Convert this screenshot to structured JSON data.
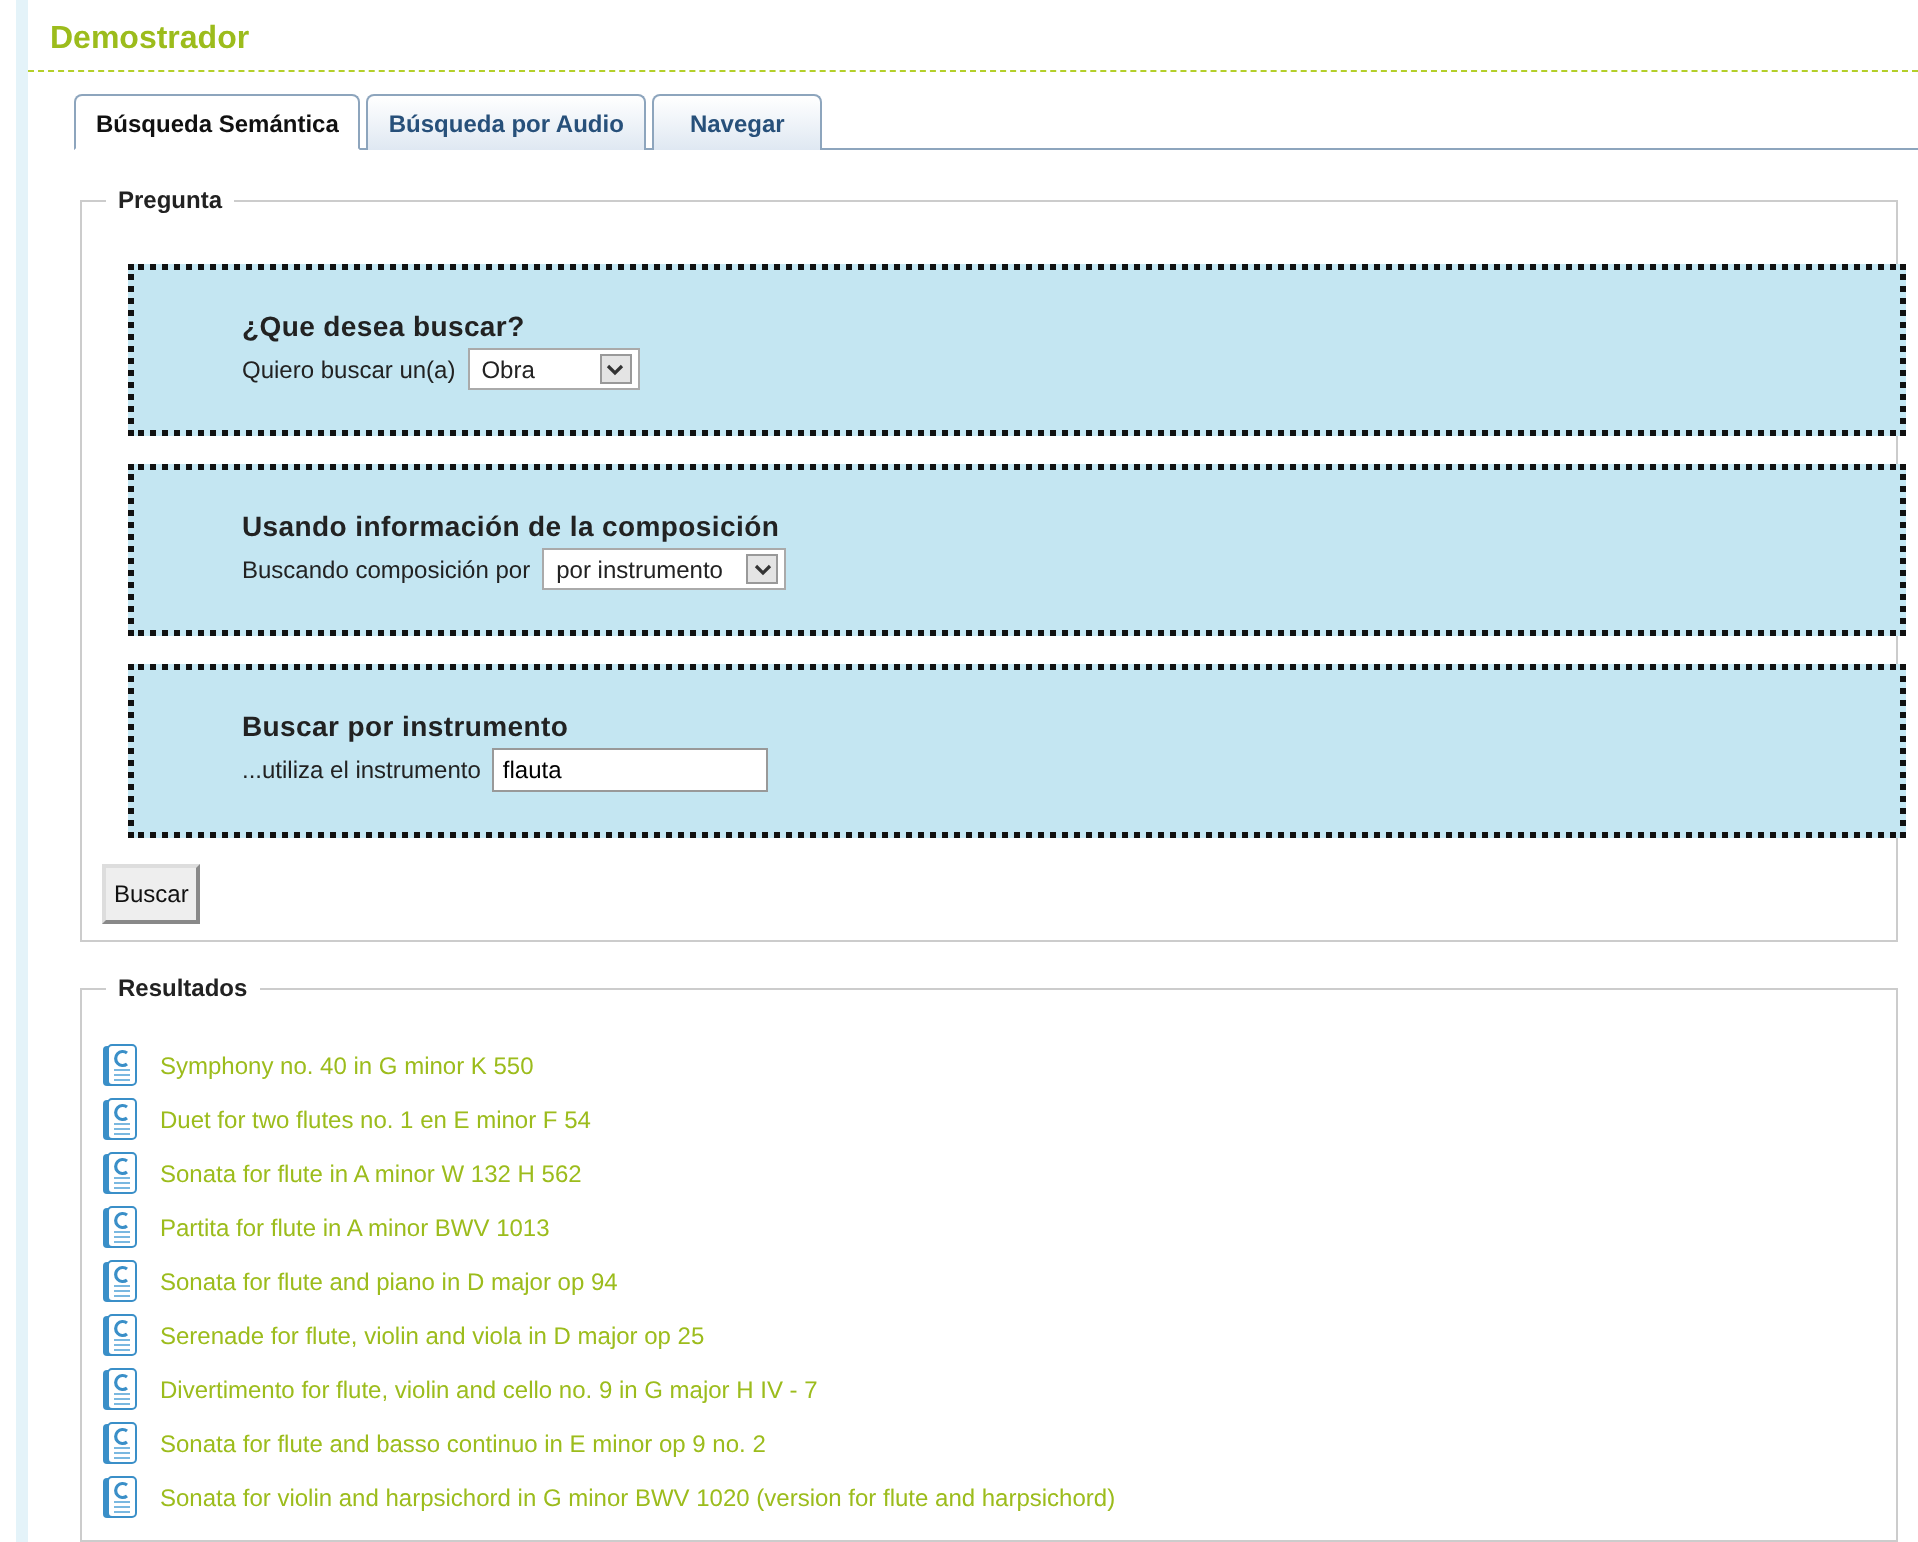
{
  "page_title": "Demostrador",
  "tabs": [
    {
      "label": "Búsqueda Semántica",
      "selected": true
    },
    {
      "label": "Búsqueda por Audio",
      "selected": false
    },
    {
      "label": "Navegar",
      "selected": false
    }
  ],
  "question": {
    "legend": "Pregunta",
    "panels": [
      {
        "heading": "¿Que desea buscar?",
        "label": "Quiero buscar un(a)",
        "kind": "select",
        "value": "Obra"
      },
      {
        "heading": "Usando información de la composición",
        "label": "Buscando composición por",
        "kind": "select",
        "value": "por instrumento"
      },
      {
        "heading": "Buscar por instrumento",
        "label": "...utiliza el instrumento",
        "kind": "text",
        "value": "flauta"
      }
    ],
    "button": "Buscar"
  },
  "results": {
    "legend": "Resultados",
    "items": [
      "Symphony no. 40 in G minor K 550",
      "Duet for two flutes no. 1 en E minor F 54",
      "Sonata for flute in A minor W 132 H 562",
      "Partita for flute in A minor BWV 1013",
      "Sonata for flute and piano in D major op 94",
      "Serenade for flute, violin and viola in D major op 25",
      "Divertimento for flute, violin and cello no. 9 in G major H IV - 7",
      "Sonata for flute and basso continuo in E minor op 9 no. 2",
      "Sonata for violin and harpsichord in G minor BWV 1020 (version for flute and harpsichord)"
    ]
  }
}
